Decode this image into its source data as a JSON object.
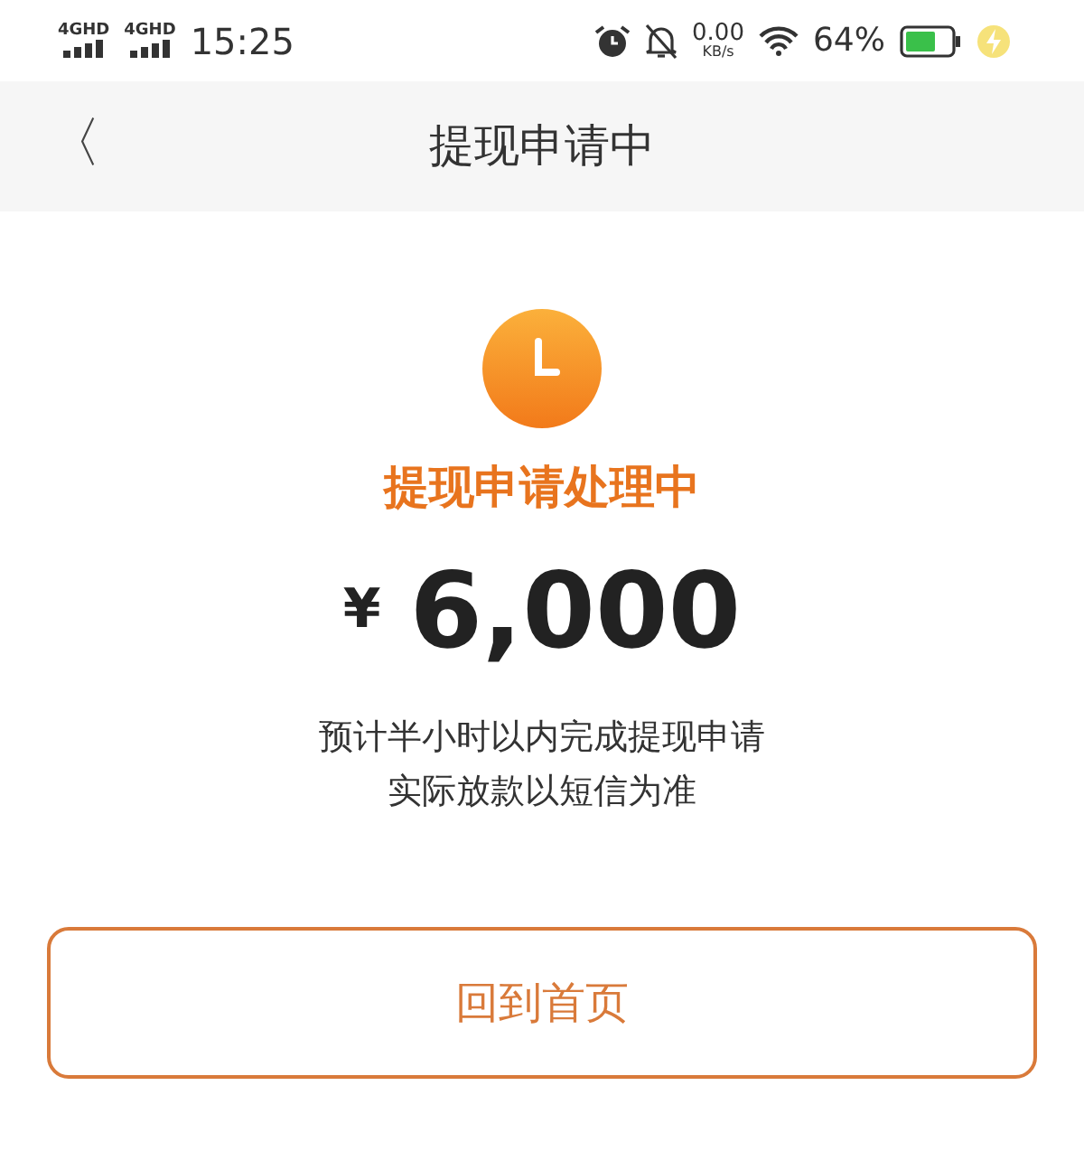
{
  "status_bar": {
    "signals": [
      {
        "label": "4G",
        "sup": "HD"
      },
      {
        "label": "4G",
        "sup": "HD"
      }
    ],
    "time": "15:25",
    "speed": "0.00",
    "speed_unit": "KB/s",
    "battery": "64%"
  },
  "header": {
    "back": "〈",
    "title": "提现申请中"
  },
  "status": {
    "title": "提现申请处理中",
    "currency": "¥",
    "amount": "6,000",
    "note": "预计半小时以内完成提现申请",
    "note2": "实际放款以短信为准"
  },
  "buttons": [
    {
      "label": "回到首页"
    }
  ]
}
